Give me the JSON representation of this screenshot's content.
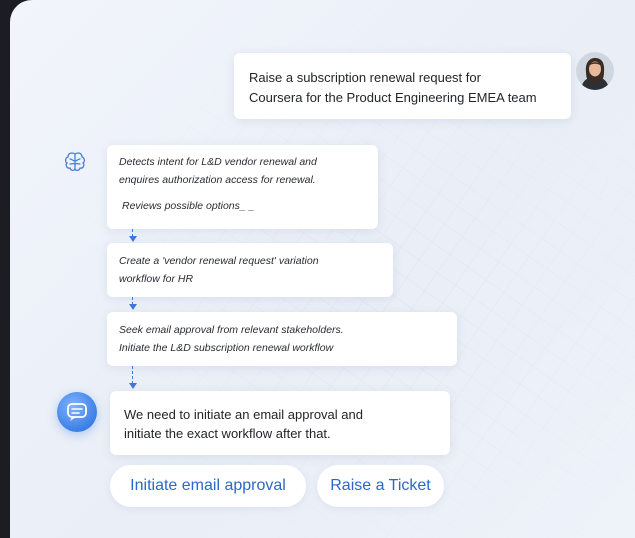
{
  "user_message": {
    "line1": "Raise a subscription renewal request for",
    "line2": "Coursera for the Product Engineering EMEA team"
  },
  "steps": [
    {
      "line1": "Detects intent for L&D vendor renewal and",
      "line2": "enquires authorization access for renewal.",
      "sub": "Reviews possible options_ _"
    },
    {
      "line1": "Create a 'vendor renewal request' variation",
      "line2": "workflow for HR"
    },
    {
      "line1": "Seek email approval from relevant  stakeholders.",
      "line2": "Initiate the L&D subscription renewal workflow"
    }
  ],
  "bot_message": {
    "line1": "We need to initiate an email approval and",
    "line2": "initiate the exact workflow after that."
  },
  "actions": {
    "email_approval": "Initiate email approval",
    "raise_ticket": "Raise a Ticket"
  },
  "icons": {
    "user_avatar": "user-avatar",
    "reasoning": "brain-icon",
    "bot": "chat-bot-icon"
  },
  "colors": {
    "accent": "#2d67c9",
    "connector": "#3f78d8",
    "panel_bg": "#eef2f9",
    "outer_bg": "#1c1d22"
  }
}
